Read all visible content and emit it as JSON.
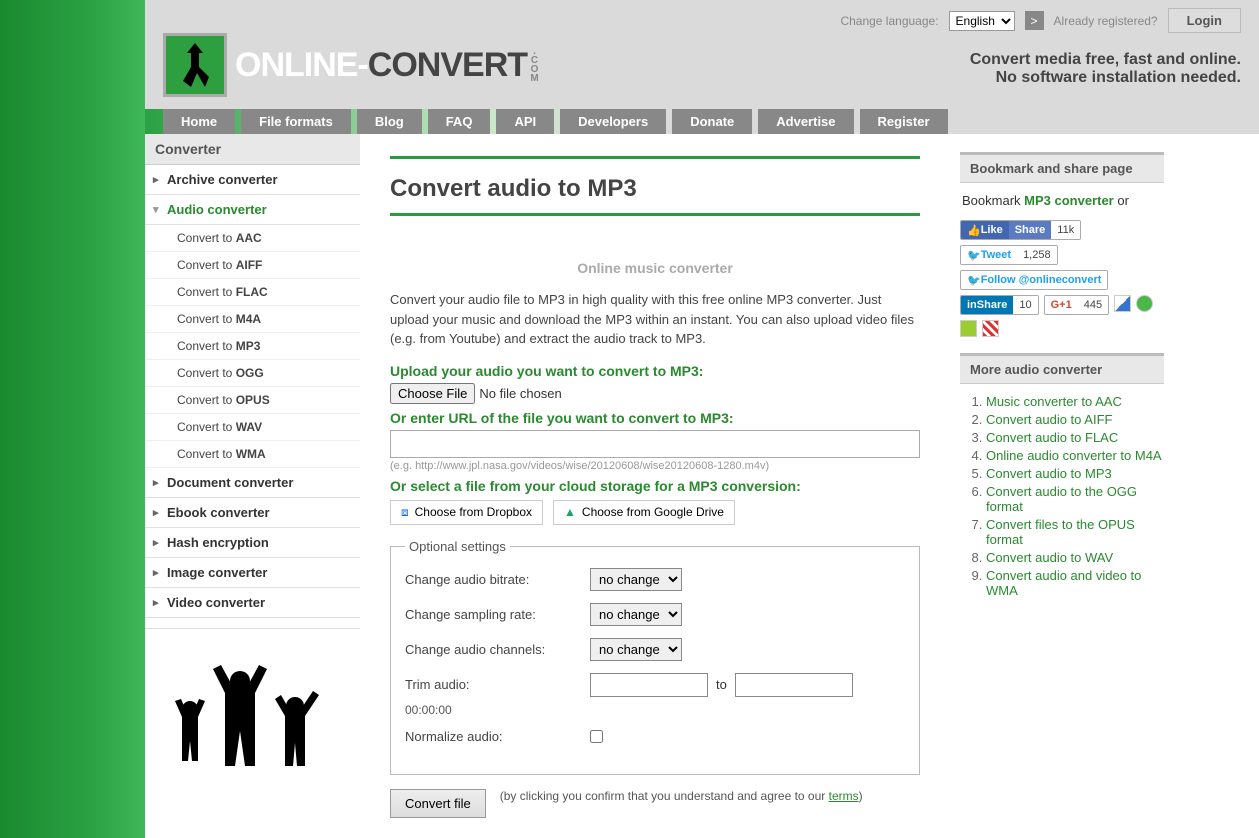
{
  "topbar": {
    "change_lang": "Change language:",
    "lang_value": "English",
    "go": ">",
    "already": "Already registered?",
    "login": "Login"
  },
  "logo": {
    "part1": "ONLINE-",
    "part2": "CONVERT",
    "dotcom": ".COM"
  },
  "tagline": {
    "l1": "Convert media free, fast and online.",
    "l2": "No software installation needed."
  },
  "nav": [
    "Home",
    "File formats",
    "Blog",
    "FAQ",
    "API",
    "Developers",
    "Donate",
    "Advertise",
    "Register"
  ],
  "sidebar": {
    "title": "Converter",
    "cats": [
      "Archive converter",
      "Audio converter",
      "Document converter",
      "Ebook converter",
      "Hash encryption",
      "Image converter",
      "Video converter"
    ],
    "subs_prefix": "Convert to ",
    "subs": [
      "AAC",
      "AIFF",
      "FLAC",
      "M4A",
      "MP3",
      "OGG",
      "OPUS",
      "WAV",
      "WMA"
    ]
  },
  "main": {
    "h1": "Convert audio to MP3",
    "subh": "Online music converter",
    "desc": "Convert your audio file to MP3 in high quality with this free online MP3 converter. Just upload your music and download the MP3 within an instant. You can also upload video files (e.g. from Youtube) and extract the audio track to MP3.",
    "upload_label": "Upload your audio you want to convert to MP3:",
    "no_file": "No file chosen",
    "url_label": "Or enter URL of the file you want to convert to MP3:",
    "url_hint": "(e.g. http://www.jpl.nasa.gov/videos/wise/20120608/wise20120608-1280.m4v)",
    "cloud_label": "Or select a file from your cloud storage for a MP3 conversion:",
    "dropbox": "Choose from Dropbox",
    "gdrive": "Choose from Google Drive",
    "legend": "Optional settings",
    "bitrate_lbl": "Change audio bitrate:",
    "sampling_lbl": "Change sampling rate:",
    "channels_lbl": "Change audio channels:",
    "nochange": "no change",
    "trim_lbl": "Trim audio:",
    "trim_to": "to",
    "time_hint": "00:00:00",
    "normalize_lbl": "Normalize audio:",
    "convert_btn": "Convert file",
    "disclaim1": "(by clicking you confirm that you understand and agree to our ",
    "disclaim_terms": "terms",
    "disclaim2": ")"
  },
  "right": {
    "bm_h": "Bookmark and share page",
    "bm_text1": "Bookmark ",
    "bm_link": "MP3 converter",
    "bm_text2": " or",
    "fb_like": "Like",
    "fb_share": "Share",
    "fb_cnt": "11k",
    "tw": "Tweet",
    "tw_cnt": "1,258",
    "tw_follow": "Follow @onlineconvert",
    "li": "Share",
    "li_cnt": "10",
    "gp": "G+1",
    "gp_cnt": "445",
    "more_h": "More audio converter",
    "more": [
      "Music converter to AAC",
      "Convert audio to AIFF",
      "Convert audio to FLAC",
      "Online audio converter to M4A",
      "Convert audio to MP3",
      "Convert audio to the OGG format",
      "Convert files to the OPUS format",
      "Convert audio to WAV",
      "Convert audio and video to WMA"
    ]
  }
}
